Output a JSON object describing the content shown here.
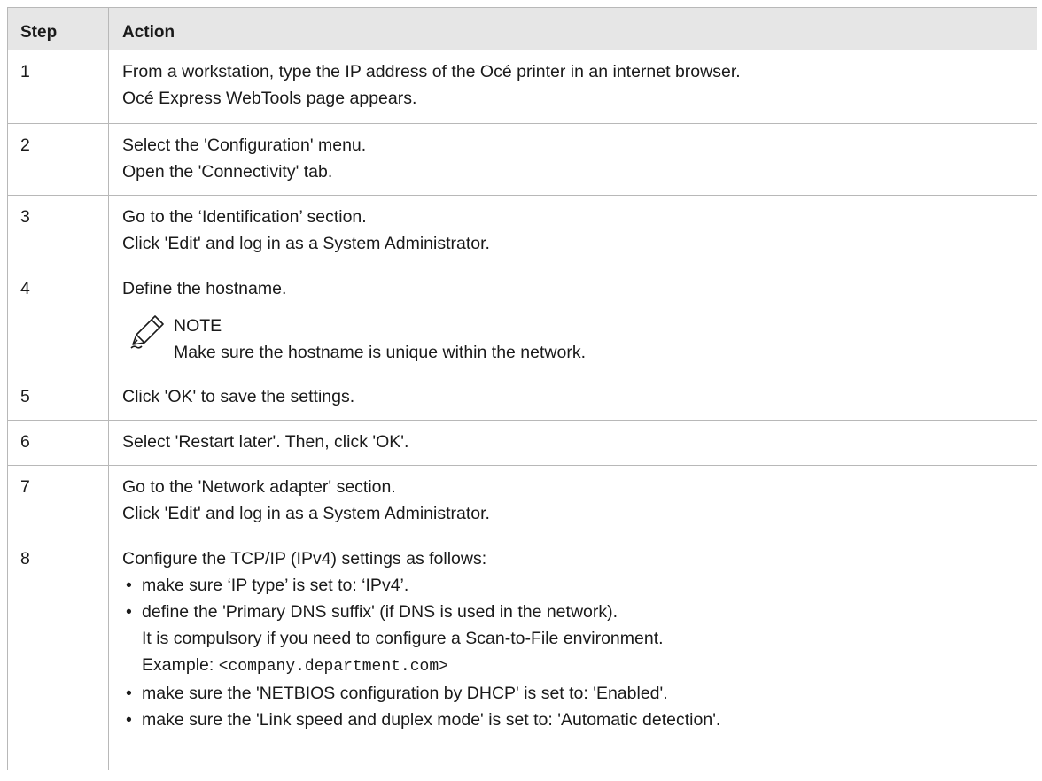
{
  "table": {
    "header": {
      "step": "Step",
      "action": "Action"
    },
    "rows": [
      {
        "step": "1",
        "lines": [
          "From a workstation, type the IP address of the Océ printer in an internet browser.",
          "Océ Express WebTools page appears."
        ]
      },
      {
        "step": "2",
        "lines": [
          "Select the 'Configuration' menu.",
          "Open the 'Connectivity' tab."
        ]
      },
      {
        "step": "3",
        "lines": [
          "Go to the ‘Identification’ section.",
          "Click 'Edit' and log in as a System Administrator."
        ]
      },
      {
        "step": "4",
        "lines": [
          "Define the hostname."
        ],
        "note": {
          "title": "NOTE",
          "text": "Make sure the hostname is unique within the network.",
          "icon": "pencil-note-icon"
        }
      },
      {
        "step": "5",
        "lines": [
          "Click 'OK' to save the settings."
        ]
      },
      {
        "step": "6",
        "lines": [
          "Select 'Restart later'. Then, click 'OK'."
        ]
      },
      {
        "step": "7",
        "lines": [
          "Go to the 'Network adapter' section.",
          "Click 'Edit' and log in as a System Administrator."
        ]
      },
      {
        "step": "8",
        "intro": "Configure the TCP/IP (IPv4) settings as follows:",
        "bullets": [
          {
            "text": "make sure ‘IP type’ is set to: ‘IPv4’."
          },
          {
            "text": "define the 'Primary DNS suffix' (if DNS is used in the network).",
            "extra": "It is compulsory if you need to configure a Scan-to-File environment.",
            "example_label": "Example: ",
            "example_code": "<company.department.com>"
          },
          {
            "text": "make sure the 'NETBIOS configuration by DHCP' is set to: 'Enabled'."
          },
          {
            "text": "make sure the 'Link speed and duplex mode' is set to: 'Automatic detection'."
          }
        ]
      }
    ]
  }
}
